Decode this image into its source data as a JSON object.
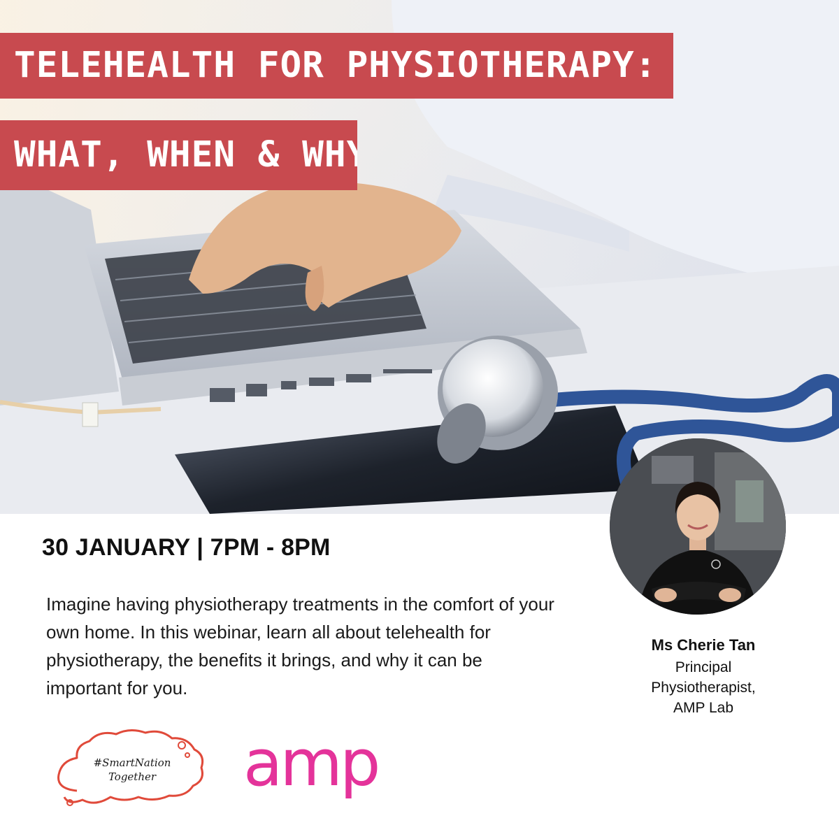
{
  "title": {
    "line1": "TELEHEALTH FOR PHYSIOTHERAPY:",
    "line2": "WHAT, WHEN & WHY"
  },
  "event": {
    "date_time": "30 JANUARY | 7PM - 8PM"
  },
  "description": "Imagine having physiotherapy treatments in the comfort of your own home. In this webinar, learn all about telehealth for physiotherapy, the benefits it brings, and why it can be important for you.",
  "speaker": {
    "name": "Ms Cherie Tan",
    "role_line1": "Principal",
    "role_line2": "Physiotherapist,",
    "role_line3": "AMP Lab"
  },
  "logos": {
    "smartnation_line1": "#SmartNation",
    "smartnation_line2": "Together",
    "amp": "amp"
  },
  "colors": {
    "title_band": "#c84a4f",
    "amp_brand": "#e4339a",
    "smartnation_outline": "#e04a3a"
  }
}
